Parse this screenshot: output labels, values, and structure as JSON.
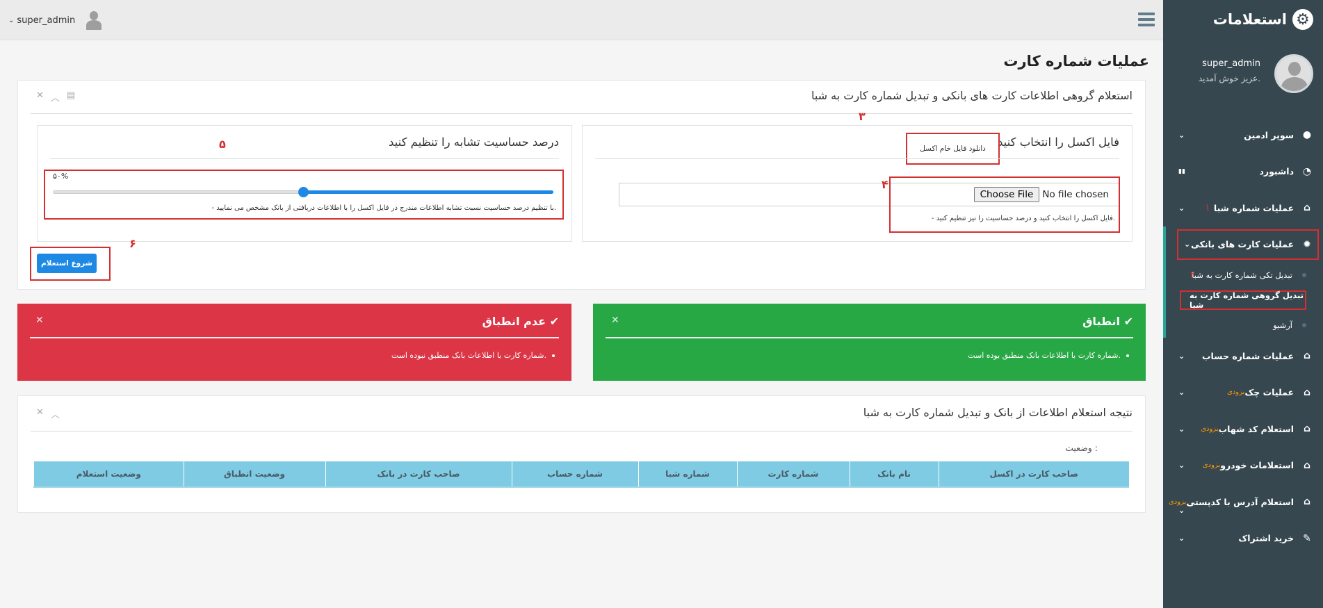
{
  "sidebar": {
    "title": "استعلامات",
    "user_name": "super_admin",
    "welcome": "عزیز خوش آمدید.",
    "soon_label": "بزودی",
    "items": [
      {
        "label": "سوپر ادمین",
        "icon": "user-icon"
      },
      {
        "label": "داشبورد",
        "icon": "dashboard-icon"
      },
      {
        "label": "عملیات شماره شبا",
        "icon": "home-icon",
        "marker": "۱"
      },
      {
        "label": "عملیات کارت های بانکی",
        "icon": "bug-icon"
      },
      {
        "label": "عملیات شماره حساب",
        "icon": "home-icon"
      },
      {
        "label": "عملیات چک",
        "icon": "home-icon",
        "soon": true
      },
      {
        "label": "استعلام کد شهاب",
        "icon": "home-icon",
        "soon": true
      },
      {
        "label": "استعلامات خودرو",
        "icon": "home-icon",
        "soon": true
      },
      {
        "label": "استعلام آدرس با کدپستی",
        "icon": "home-icon",
        "soon": true
      },
      {
        "label": "خرید اشتراک",
        "icon": "edit-icon"
      }
    ],
    "sub_items": [
      {
        "label": "تبدیل تکی شماره کارت به شبا",
        "marker": "۲"
      },
      {
        "label": "تبدیل گروهی شماره کارت به شبا"
      },
      {
        "label": "آرشیو"
      }
    ]
  },
  "topbar": {
    "user_name": "super_admin"
  },
  "page": {
    "title": "عملیات شماره کارت",
    "panel_title": "استعلام گروهی اطلاعات کارت های بانکی و تبدیل شماره کارت به شبا",
    "file_panel": {
      "title": "فایل اکسل را انتخاب کنید",
      "download_link": "دانلود فایل خام اکسل",
      "choose_button": "Choose File",
      "no_file": "No file chosen",
      "hint": "- فایل اکسل را انتخاب کنید و درصد حساسیت را نیز تنظیم کنید."
    },
    "sensitivity_panel": {
      "title": "درصد حساسیت تشابه را تنظیم کنید",
      "value_label": "۵۰%",
      "value": 0.5,
      "hint": "- با تنظیم درصد حساسیت نسبت تشابه اطلاعات مندرج در فایل اکسل را با اطلاعات دریافتی از بانک مشخص می نمایید."
    },
    "start_button": "شروع استعلام",
    "markers": {
      "m3": "۳",
      "m4": "۴",
      "m5": "۵",
      "m6": "۶"
    },
    "match_alert": {
      "title": "انطباق",
      "message": "شماره کارت با اطلاعات بانک منطبق بوده است.",
      "color": "#28a745"
    },
    "mismatch_alert": {
      "title": "عدم انطباق",
      "message": "شماره کارت با اطلاعات بانک منطبق نبوده است.",
      "color": "#dc3545"
    },
    "result_panel": {
      "title": "نتیجه استعلام اطلاعات از بانک و تبدیل شماره کارت به شبا",
      "status_label": "وضعیت :",
      "columns": [
        "صاحب کارت در اکسل",
        "نام بانک",
        "شماره کارت",
        "شماره شبا",
        "شماره حساب",
        "صاحب کارت در بانک",
        "وضعیت انطباق",
        "وضعیت استعلام"
      ]
    }
  }
}
